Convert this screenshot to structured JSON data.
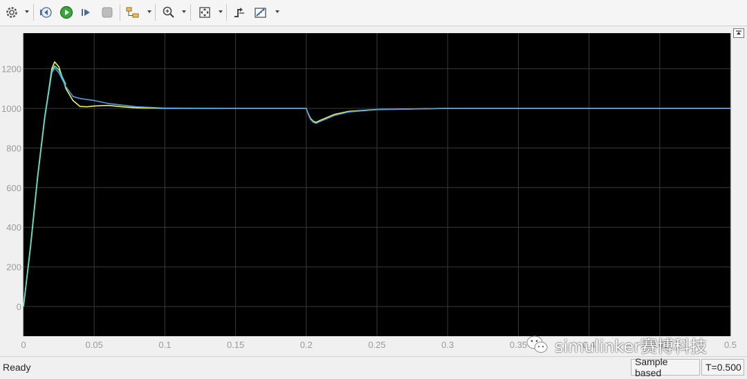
{
  "toolbar": {
    "buttons": [
      {
        "name": "settings-gear-icon"
      },
      {
        "name": "step-back-icon"
      },
      {
        "name": "run-icon"
      },
      {
        "name": "step-forward-icon"
      },
      {
        "name": "stop-icon"
      },
      {
        "name": "highlight-simulink-block-icon"
      },
      {
        "name": "zoom-in-icon"
      },
      {
        "name": "fit-to-view-icon"
      },
      {
        "name": "triggers-icon"
      },
      {
        "name": "measurement-icon"
      }
    ]
  },
  "status": {
    "ready": "Ready",
    "sample_mode": "Sample based",
    "time": "T=0.500"
  },
  "watermark": {
    "text": "simulinker赛博科技",
    "icon": "wechat-icon"
  },
  "colors": {
    "axes_bg": "#000000",
    "grid": "#3a3a3a",
    "tick_text": "#9a9a9a",
    "series_yellow": "#f2f25a",
    "series_blue": "#4f9fe8",
    "series_cyan": "#5ee3c0"
  },
  "chart_data": {
    "type": "line",
    "xlim": [
      0,
      0.5
    ],
    "ylim": [
      -150,
      1380
    ],
    "xticks": [
      0,
      0.05,
      0.1,
      0.15,
      0.2,
      0.25,
      0.3,
      0.35,
      0.4,
      0.45,
      0.5
    ],
    "xtick_labels": [
      "0",
      "0.05",
      "0.1",
      "0.15",
      "0.2",
      "0.25",
      "0.3",
      "0.35",
      "0.4",
      "0.45",
      "0.5"
    ],
    "yticks": [
      0,
      200,
      400,
      600,
      800,
      1000,
      1200
    ],
    "ytick_labels": [
      "0",
      "200",
      "400",
      "600",
      "800",
      "1000",
      "1200"
    ],
    "grid": true,
    "series": [
      {
        "color": "#f2f25a",
        "x": [
          0,
          0.005,
          0.01,
          0.015,
          0.02,
          0.022,
          0.025,
          0.03,
          0.035,
          0.04,
          0.045,
          0.05,
          0.06,
          0.07,
          0.08,
          0.1,
          0.15,
          0.2,
          0.201,
          0.203,
          0.205,
          0.207,
          0.21,
          0.22,
          0.23,
          0.25,
          0.3,
          0.5
        ],
        "y": [
          0,
          300,
          650,
          950,
          1200,
          1235,
          1210,
          1100,
          1040,
          1010,
          1008,
          1012,
          1015,
          1008,
          1003,
          1000,
          1000,
          1000,
          980,
          950,
          935,
          930,
          940,
          970,
          985,
          995,
          1000,
          1000
        ]
      },
      {
        "color": "#4f9fe8",
        "x": [
          0,
          0.005,
          0.01,
          0.015,
          0.02,
          0.022,
          0.025,
          0.03,
          0.035,
          0.04,
          0.05,
          0.06,
          0.08,
          0.1,
          0.15,
          0.2,
          0.201,
          0.203,
          0.205,
          0.207,
          0.21,
          0.22,
          0.23,
          0.25,
          0.3,
          0.5
        ],
        "y": [
          0,
          300,
          650,
          950,
          1180,
          1205,
          1180,
          1110,
          1060,
          1050,
          1040,
          1025,
          1008,
          1002,
          1000,
          1000,
          978,
          945,
          930,
          925,
          935,
          965,
          982,
          994,
          1000,
          1000
        ]
      },
      {
        "color": "#5ee3c0",
        "x": [
          0,
          0.005,
          0.01,
          0.015,
          0.02,
          0.022,
          0.025,
          0.03
        ],
        "y": [
          0,
          310,
          660,
          960,
          1190,
          1215,
          1195,
          1120
        ]
      }
    ]
  }
}
